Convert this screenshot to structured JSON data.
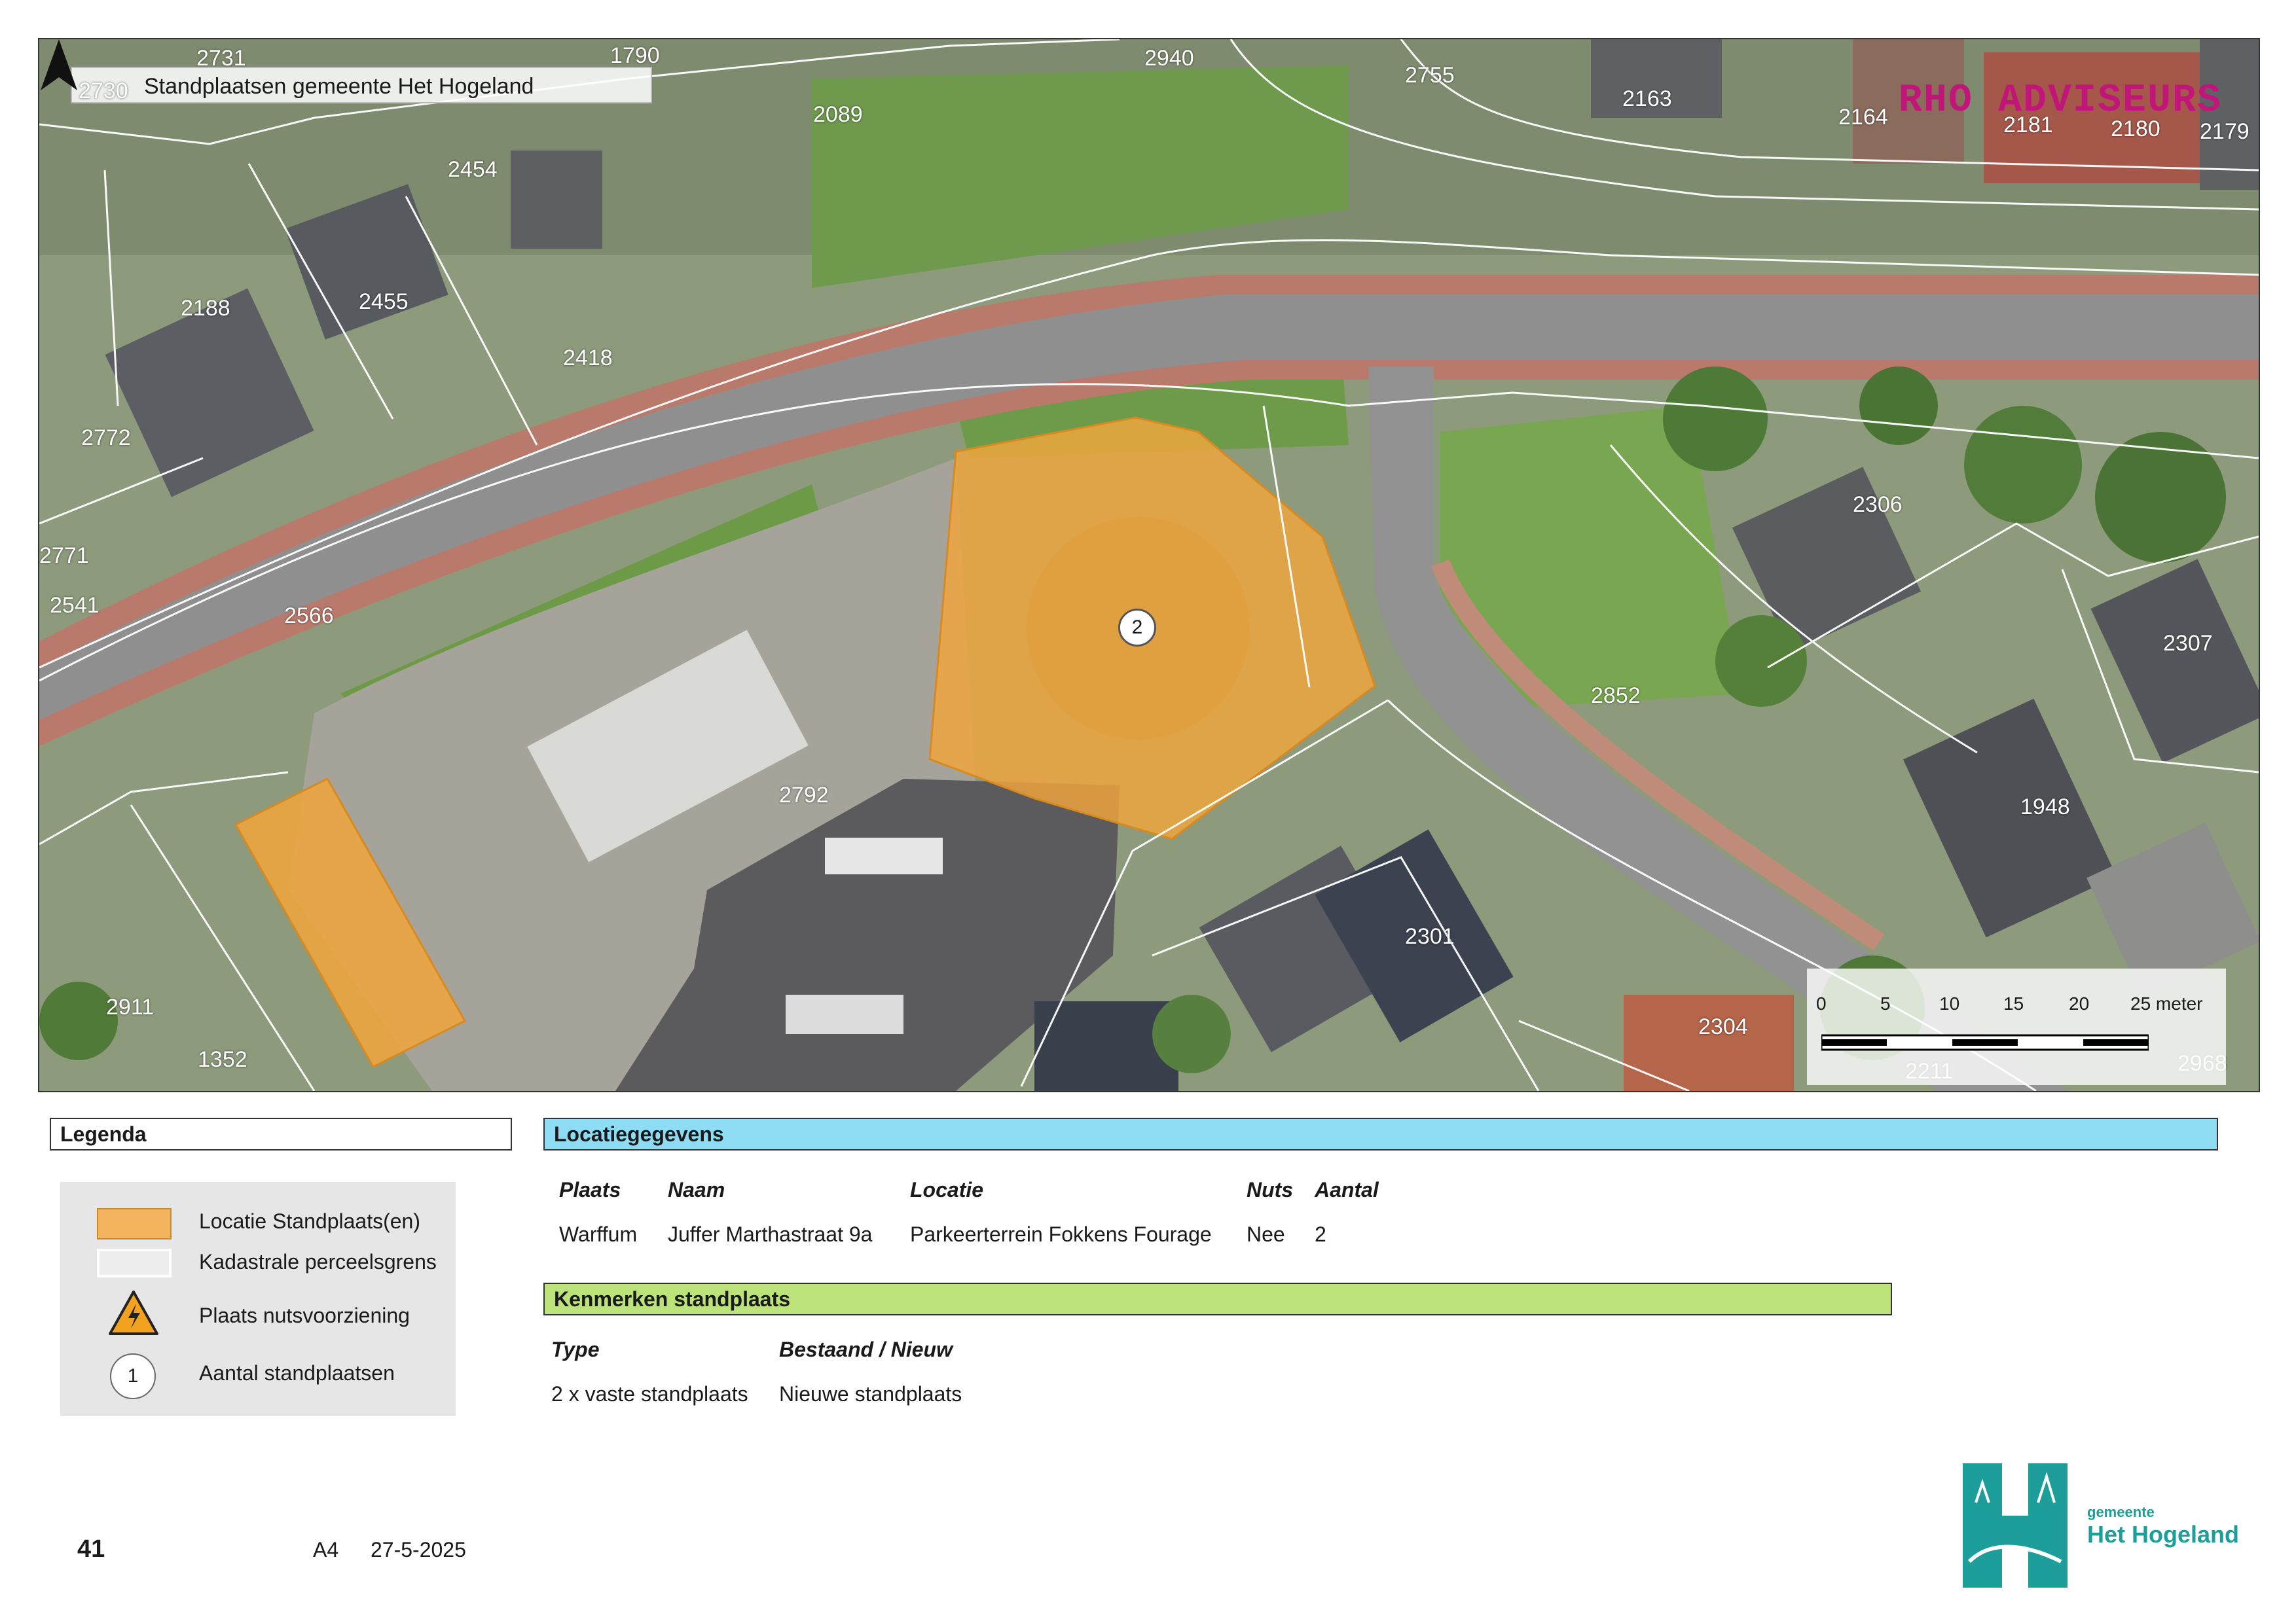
{
  "map": {
    "title": "Standplaatsen gemeente Het Hogeland",
    "brand": "RHO ADVISEURS",
    "parcels": [
      "2731",
      "2730",
      "1790",
      "2940",
      "2755",
      "2163",
      "2164",
      "2181",
      "2180",
      "2179",
      "2089",
      "2454",
      "2455",
      "2188",
      "2418",
      "2772",
      "2771",
      "2541",
      "2566",
      "2306",
      "2307",
      "2852",
      "2792",
      "1948",
      "2301",
      "2911",
      "1352",
      "2304",
      "2211",
      "2968"
    ],
    "standplaats_count": "2",
    "scale": {
      "ticks": [
        "0",
        "5",
        "10",
        "15",
        "20",
        "25 meter"
      ]
    },
    "colors": {
      "location": "#f2a63c",
      "boundary": "#ffffff"
    }
  },
  "legend": {
    "title": "Legenda",
    "items": [
      "Locatie Standplaats(en)",
      "Kadastrale perceelsgrens",
      "Plaats nutsvoorziening",
      "Aantal standplaatsen"
    ],
    "count_symbol": "1"
  },
  "location_data": {
    "title": "Locatiegegevens",
    "headers": [
      "Plaats",
      "Naam",
      "Locatie",
      "Nuts",
      "Aantal"
    ],
    "row": [
      "Warffum",
      "Juffer Marthastraat 9a",
      "Parkeerterrein Fokkens Fourage",
      "Nee",
      "2"
    ]
  },
  "characteristics": {
    "title": "Kenmerken standplaats",
    "headers": [
      "Type",
      "Bestaand / Nieuw"
    ],
    "row": [
      "2 x vaste standplaats",
      "Nieuwe standplaats"
    ]
  },
  "footer": {
    "page": "41",
    "format": "A4",
    "date": "27-5-2025"
  },
  "municipality_logo": {
    "line1": "gemeente",
    "line2": "Het Hogeland"
  }
}
